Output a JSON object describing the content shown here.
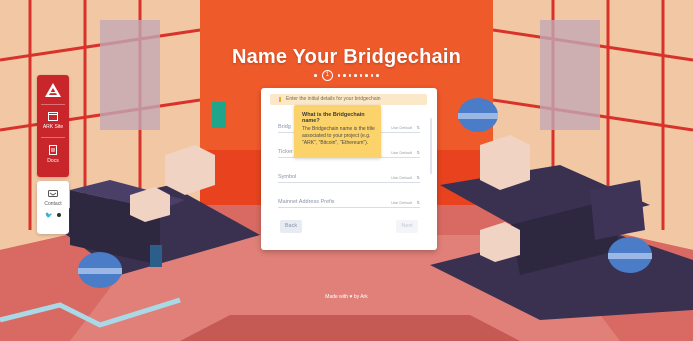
{
  "header": {
    "title": "Name Your Bridgechain",
    "current_step": "1"
  },
  "sidebar": {
    "items": [
      {
        "label": "ARK Site",
        "icon": "window-icon"
      },
      {
        "label": "Docs",
        "icon": "document-icon"
      }
    ],
    "contact": {
      "label": "Contact",
      "icons": [
        "twitter-icon",
        "circle-icon"
      ]
    }
  },
  "form": {
    "alert_text": "Enter the initial details for your bridgechain",
    "fields": [
      {
        "label": "Bridg",
        "default": "Use Default",
        "toggle": "⇅"
      },
      {
        "label": "Ticker",
        "default": "Use Default",
        "toggle": "⇅"
      },
      {
        "label": "Symbol",
        "default": "Use Default",
        "toggle": "⇅"
      },
      {
        "label": "Mainnet Address Prefix",
        "default": "Use Default",
        "toggle": "⇅"
      }
    ],
    "back_label": "Back",
    "next_label": "Next"
  },
  "tooltip": {
    "title": "What is the Bridgechain name?",
    "body": "The Bridgechain name is the title associated to your project (e.g. \"ARK\", \"Bitcoin\", \"Ethereum\")."
  },
  "footer": {
    "text": "Made with ♥ by Ark"
  },
  "colors": {
    "accent": "#c9262c",
    "background_top": "#e8431e",
    "tooltip": "#fbd36a"
  }
}
